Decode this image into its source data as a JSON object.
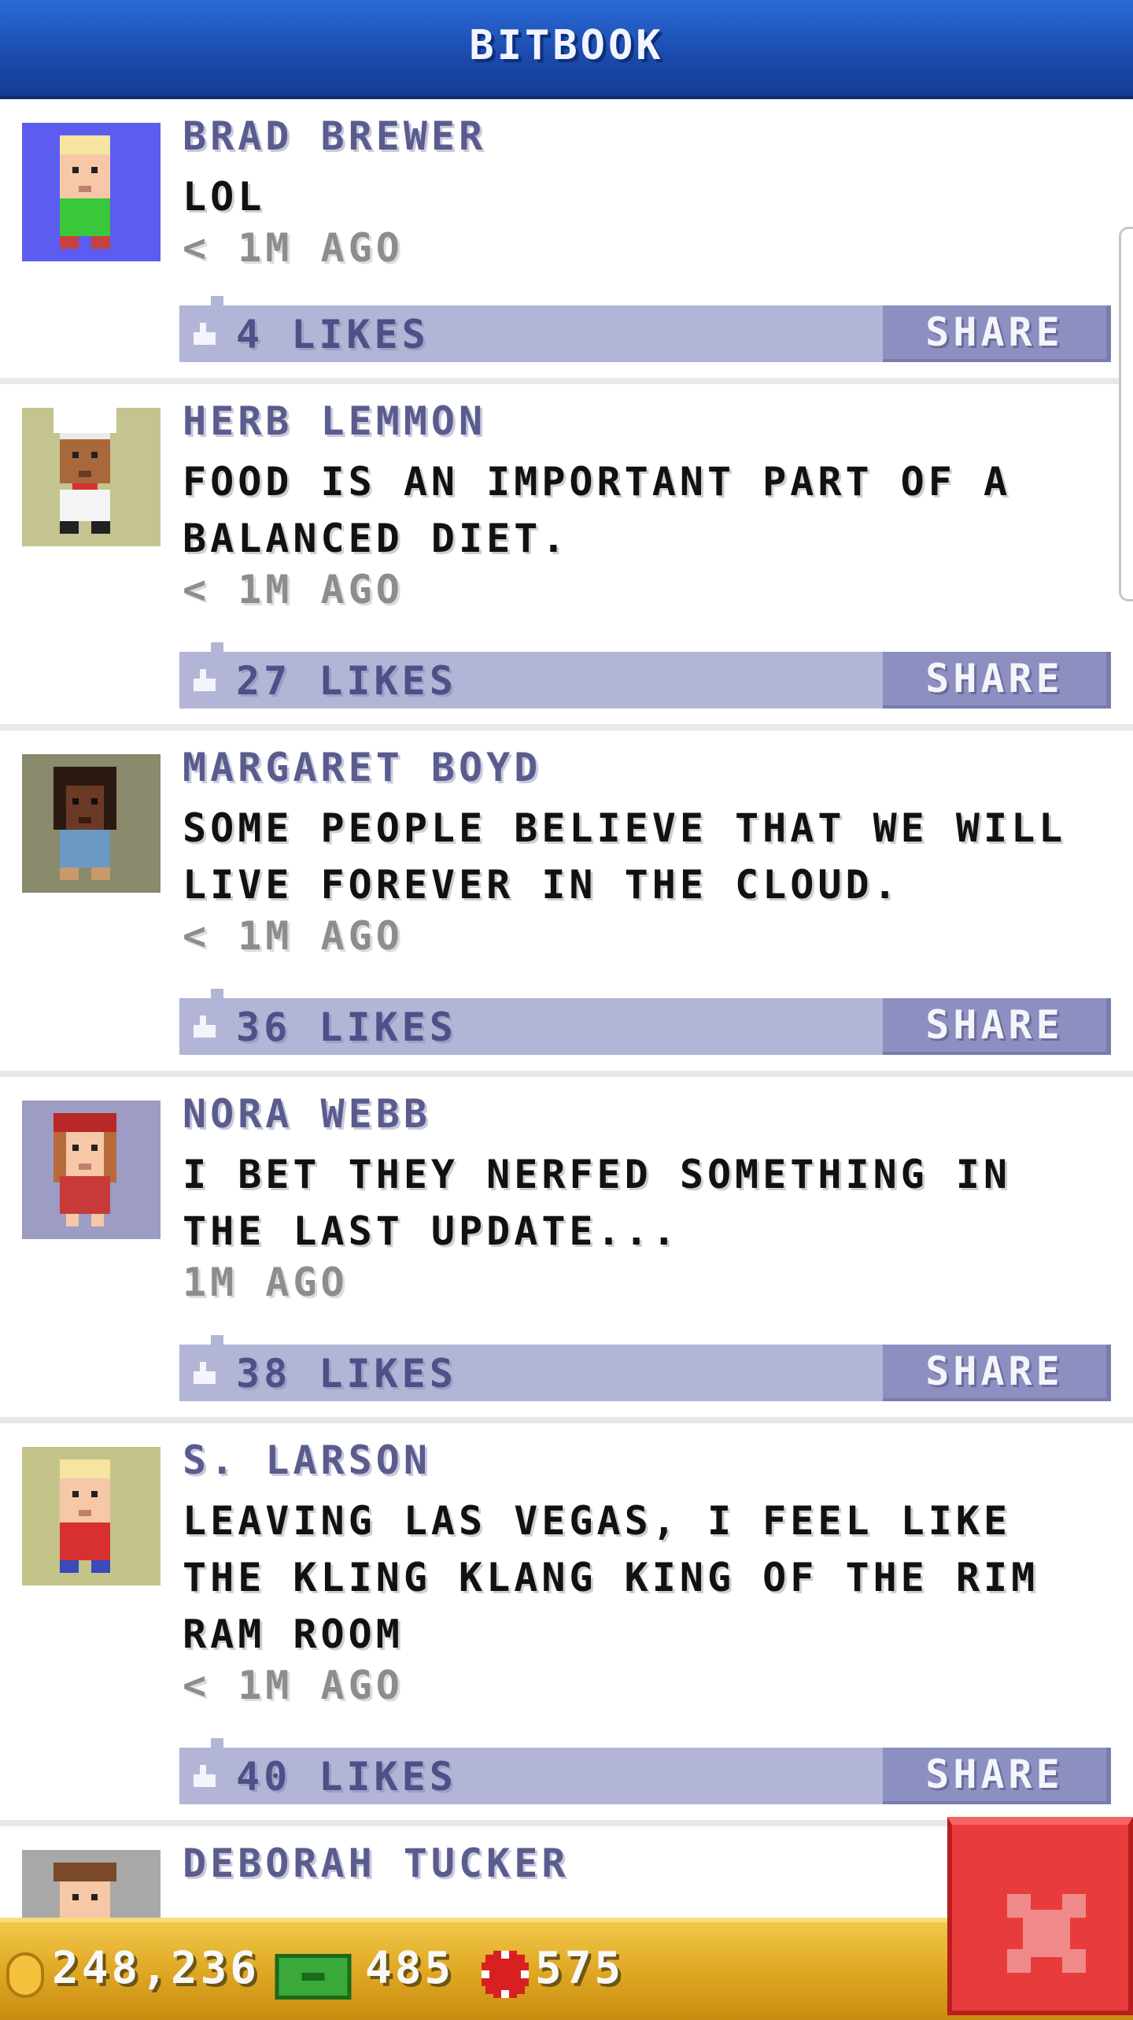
{
  "header": {
    "title": "BITBOOK"
  },
  "posts": [
    {
      "name": "BRAD BREWER",
      "message": "LOL",
      "time": "< 1M AGO",
      "likes": "4 LIKES",
      "share": "SHARE",
      "avatar": "blond-resident-green-shirt"
    },
    {
      "name": "HERB LEMMON",
      "message": "FOOD IS AN IMPORTANT PART OF A BALANCED DIET.",
      "time": "< 1M AGO",
      "likes": "27 LIKES",
      "share": "SHARE",
      "avatar": "chef-resident"
    },
    {
      "name": "MARGARET BOYD",
      "message": "SOME PEOPLE BELIEVE THAT WE WILL LIVE FOREVER IN THE CLOUD.",
      "time": "< 1M AGO",
      "likes": "36 LIKES",
      "share": "SHARE",
      "avatar": "resident-blue-shirt"
    },
    {
      "name": "NORA WEBB",
      "message": "I BET THEY NERFED SOMETHING IN THE LAST UPDATE...",
      "time": "1M AGO",
      "likes": "38 LIKES",
      "share": "SHARE",
      "avatar": "red-hair-resident"
    },
    {
      "name": "S. LARSON",
      "message": "LEAVING LAS VEGAS, I FEEL LIKE THE KLING KLANG KING OF THE RIM RAM ROOM",
      "time": "< 1M AGO",
      "likes": "40 LIKES",
      "share": "SHARE",
      "avatar": "blond-resident-red-shirt"
    },
    {
      "name": "DEBORAH TUCKER",
      "avatar": "brown-hair-resident"
    }
  ],
  "bottom_bar": {
    "coins": "248,236",
    "bux": "485",
    "chips": "575"
  },
  "close_button": {
    "icon": "close-icon"
  },
  "colors": {
    "header": "#1a4aaa",
    "name": "#5a5c8e",
    "likebar": "#b3b5d7",
    "share": "#8c8fc0",
    "close": "#e83c3c",
    "bar": "#e0a824"
  }
}
